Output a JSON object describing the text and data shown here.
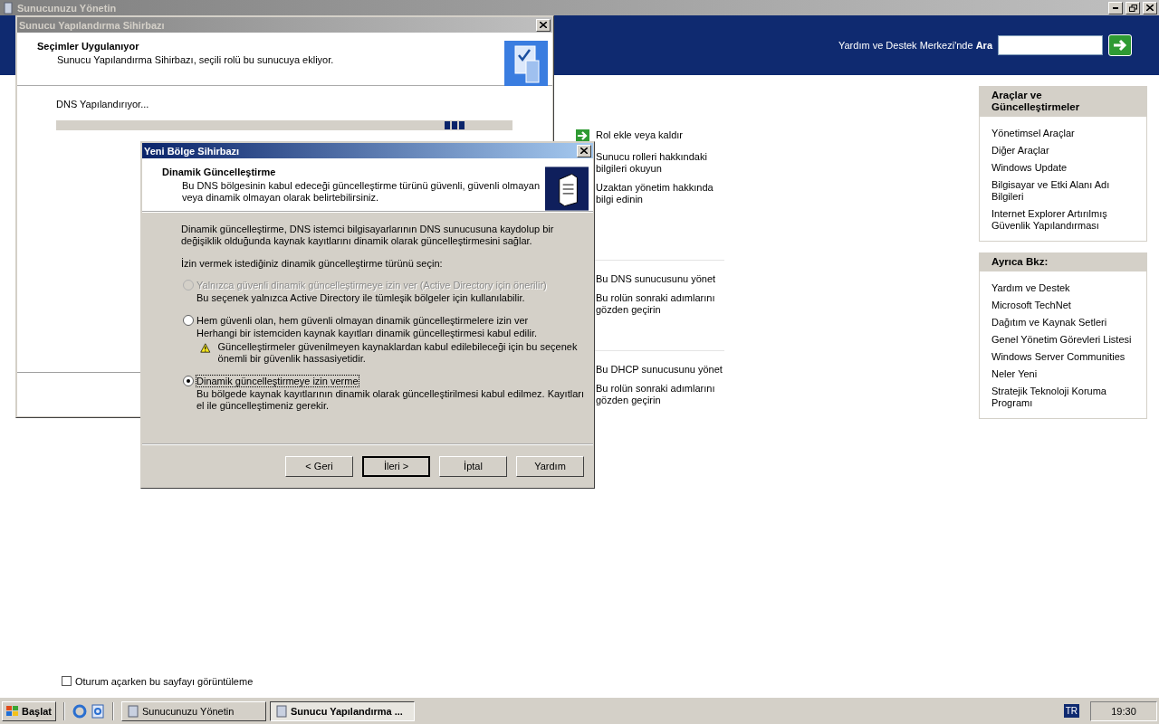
{
  "main_window": {
    "title": "Sunucunuzu Yönetin",
    "search_label": "Yardım ve Destek Merkezi'nde **Ara**"
  },
  "task_groups": [
    {
      "links": [
        {
          "text": "Rol ekle veya kaldır",
          "kind": "arrow"
        },
        {
          "text": "Sunucu rolleri hakkındaki bilgileri okuyun",
          "kind": "plain"
        },
        {
          "text": "Uzaktan yönetim hakkında bilgi edinin",
          "kind": "plain"
        }
      ]
    },
    {
      "links": [
        {
          "text": "Bu DNS sunucusunu yönet",
          "kind": "plain"
        },
        {
          "text": "Bu rolün sonraki adımlarını gözden geçirin",
          "kind": "plain"
        }
      ]
    },
    {
      "links": [
        {
          "text": "Bu DHCP sunucusunu yönet",
          "kind": "plain"
        },
        {
          "text": "Bu rolün sonraki adımlarını gözden geçirin",
          "kind": "plain"
        }
      ]
    }
  ],
  "panels": [
    {
      "title": "Araçlar ve Güncelleştirmeler",
      "links": [
        "Yönetimsel Araçlar",
        "Diğer Araçlar",
        "Windows Update",
        "Bilgisayar ve Etki Alanı Adı Bilgileri",
        "Internet Explorer Artırılmış Güvenlik Yapılandırması"
      ]
    },
    {
      "title": "Ayrıca Bkz:",
      "links": [
        "Yardım ve Destek",
        "Microsoft TechNet",
        "Dağıtım ve Kaynak Setleri",
        "Genel Yönetim Görevleri Listesi",
        "Windows Server Communities",
        "Neler Yeni",
        "Stratejik Teknoloji Koruma Programı"
      ]
    }
  ],
  "checkbox": {
    "label": "Oturum açarken bu sayfayı görüntüleme",
    "checked": false
  },
  "wizard": {
    "title": "Sunucu Yapılandırma Sihirbazı",
    "heading": "Seçimler Uygulanıyor",
    "subtitle": "Sunucu Yapılandırma Sihirbazı, seçili rolü bu sunucuya ekliyor.",
    "status": "DNS Yapılandırıyor..."
  },
  "dialog": {
    "title": "Yeni Bölge Sihirbazı",
    "heading": "Dinamik Güncelleştirme",
    "subtitle": "Bu DNS bölgesinin kabul edeceği güncelleştirme türünü güvenli, güvenli olmayan veya dinamik olmayan olarak belirtebilirsiniz.",
    "intro": "Dinamik güncelleştirme, DNS istemci bilgisayarlarının DNS sunucusuna kaydolup bir değişiklik olduğunda kaynak kayıtlarını dinamik olarak güncelleştirmesini sağlar.",
    "prompt": "İzin vermek istediğiniz dinamik güncelleştirme türünü seçin:",
    "options": [
      {
        "label": "Yalnızca güvenli dinamik güncelleştirmeye izin ver (Active Directory için önerilir)",
        "description": "Bu seçenek yalnızca Active Directory ile tümleşik bölgeler için kullanılabilir.",
        "selected": false,
        "disabled": true
      },
      {
        "label": "Hem güvenli olan, hem güvenli olmayan dinamik güncelleştirmelere izin ver",
        "description": "Herhangi bir istemciden kaynak kayıtları dinamik güncelleştirmesi kabul edilir.",
        "warning": "Güncelleştirmeler güvenilmeyen kaynaklardan kabul edilebileceği için bu seçenek önemli bir güvenlik hassasiyetidir.",
        "selected": false,
        "disabled": false
      },
      {
        "label": "Dinamik güncelleştirmeye izin verme",
        "description": "Bu bölgede kaynak kayıtlarının dinamik olarak güncelleştirilmesi kabul edilmez. Kayıtları el ile güncelleştimeniz gerekir.",
        "selected": true,
        "disabled": false
      }
    ],
    "buttons": [
      {
        "label": "< Geri",
        "default": false
      },
      {
        "label": "İleri >",
        "default": true
      },
      {
        "label": "İptal",
        "default": false
      },
      {
        "label": "Yardım",
        "default": false
      }
    ]
  },
  "taskbar": {
    "start": "Başlat",
    "tasks": [
      {
        "label": "Sunucunuzu Yönetin",
        "selected": false
      },
      {
        "label": "Sunucu Yapılandırma ...",
        "selected": true
      }
    ],
    "language": "TR",
    "clock": "19:30"
  }
}
